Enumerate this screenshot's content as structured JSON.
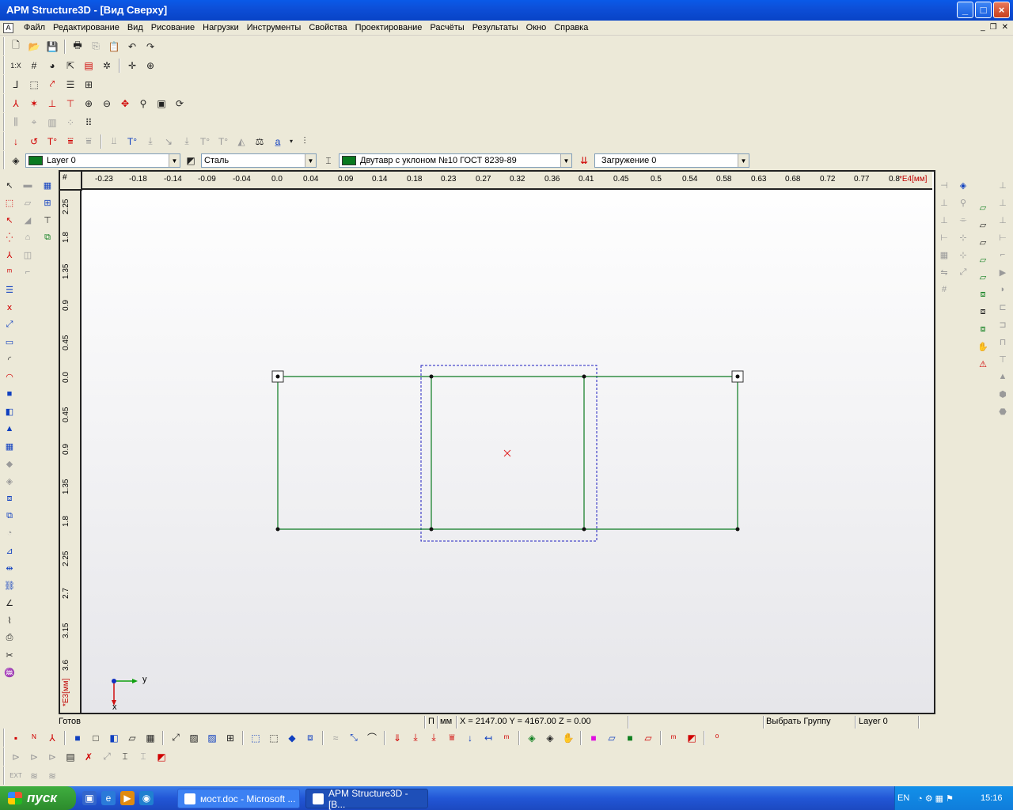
{
  "window": {
    "title": "APM Structure3D - [Вид Сверху]"
  },
  "menu": [
    "Файл",
    "Редактирование",
    "Вид",
    "Рисование",
    "Нагрузки",
    "Инструменты",
    "Свойства",
    "Проектирование",
    "Расчёты",
    "Результаты",
    "Окно",
    "Справка"
  ],
  "combos": {
    "layer": "Layer 0",
    "material": "Сталь",
    "section": "Двутавр с уклоном  №10 ГОСТ 8239-89",
    "loading": "Загружение 0"
  },
  "ruler": {
    "corner_label": "#",
    "h_ticks": [
      "-0.23",
      "-0.18",
      "-0.14",
      "-0.09",
      "-0.04",
      "0.0",
      "0.04",
      "0.09",
      "0.14",
      "0.18",
      "0.23",
      "0.27",
      "0.32",
      "0.36",
      "0.41",
      "0.45",
      "0.5",
      "0.54",
      "0.58",
      "0.63",
      "0.68",
      "0.72",
      "0.77",
      "0.8"
    ],
    "h_unit": "*E4[мм]",
    "v_ticks": [
      "2.25",
      "1.8",
      "1.35",
      "0.9",
      "0.45",
      "0.0",
      "0.45",
      "0.9",
      "1.35",
      "1.8",
      "2.25",
      "2.7",
      "3.15",
      "3.6"
    ],
    "v_unit": "*E3[мм]"
  },
  "axes": {
    "y_label": "y",
    "x_label": "x"
  },
  "status": {
    "ready": "Готов",
    "mode": "П",
    "unit": "мм",
    "coords": "X = 2147.00 Y = 4167.00 Z = 0.00",
    "command": "Выбрать Группу",
    "layer": "Layer 0"
  },
  "taskbar": {
    "start": "пуск",
    "tasks": [
      "мост.doc - Microsoft ...",
      "APM Structure3D - [В..."
    ],
    "lang": "EN",
    "clock": "15:16"
  },
  "colors": {
    "frame": "#0a7a20",
    "selection": "#2020c0",
    "center_mark": "#e02020"
  }
}
